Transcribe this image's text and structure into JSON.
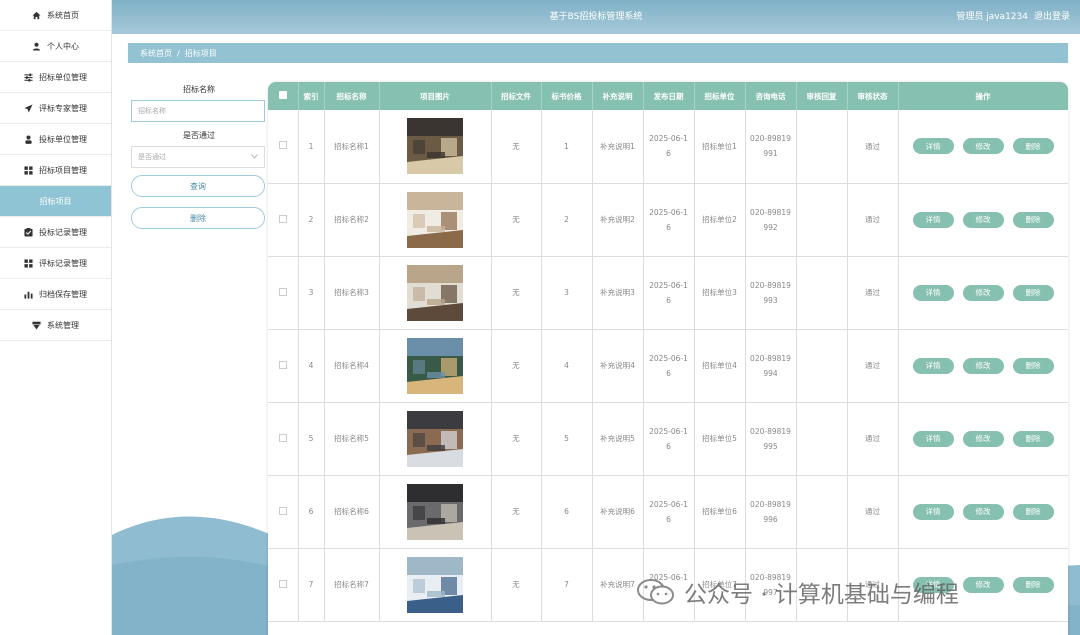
{
  "header": {
    "title": "基于BS招投标管理系统",
    "user_label": "管理员 java1234",
    "logout_label": "退出登录"
  },
  "sidebar": {
    "items": [
      {
        "label": "系统首页",
        "icon": "home-icon"
      },
      {
        "label": "个人中心",
        "icon": "user-icon"
      },
      {
        "label": "招标单位管理",
        "icon": "sliders-icon"
      },
      {
        "label": "评标专家管理",
        "icon": "send-icon"
      },
      {
        "label": "投标单位管理",
        "icon": "person-icon"
      },
      {
        "label": "招标项目管理",
        "icon": "grid-icon"
      },
      {
        "label": "招标项目",
        "icon": ""
      },
      {
        "label": "投标记录管理",
        "icon": "checkbox-icon"
      },
      {
        "label": "评标记录管理",
        "icon": "grid-icon"
      },
      {
        "label": "归档保存管理",
        "icon": "bar-chart-icon"
      },
      {
        "label": "系统管理",
        "icon": "shield-icon"
      }
    ]
  },
  "breadcrumb": {
    "home": "系统首页",
    "separator": "/",
    "current": "招标项目"
  },
  "search": {
    "name_label": "招标名称",
    "name_placeholder": "招标名称",
    "approved_label": "是否通过",
    "approved_placeholder": "是否通过",
    "query_button": "查询",
    "delete_button": "删除"
  },
  "table": {
    "headers": [
      "索引",
      "招标名称",
      "项目图片",
      "招标文件",
      "标书价格",
      "补充说明",
      "发布日期",
      "招标单位",
      "咨询电话",
      "审核回复",
      "审核状态",
      "操作"
    ],
    "rows": [
      {
        "index": "1",
        "name": "招标名称1",
        "file": "无",
        "price": "1",
        "note": "补充说明1",
        "date": [
          "2025-06-1",
          "6"
        ],
        "unit": "招标单位1",
        "phone": [
          "020-89819",
          "991"
        ],
        "reply": "",
        "status": "通过"
      },
      {
        "index": "2",
        "name": "招标名称2",
        "file": "无",
        "price": "2",
        "note": "补充说明2",
        "date": [
          "2025-06-1",
          "6"
        ],
        "unit": "招标单位2",
        "phone": [
          "020-89819",
          "992"
        ],
        "reply": "",
        "status": "通过"
      },
      {
        "index": "3",
        "name": "招标名称3",
        "file": "无",
        "price": "3",
        "note": "补充说明3",
        "date": [
          "2025-06-1",
          "6"
        ],
        "unit": "招标单位3",
        "phone": [
          "020-89819",
          "993"
        ],
        "reply": "",
        "status": "通过"
      },
      {
        "index": "4",
        "name": "招标名称4",
        "file": "无",
        "price": "4",
        "note": "补充说明4",
        "date": [
          "2025-06-1",
          "6"
        ],
        "unit": "招标单位4",
        "phone": [
          "020-89819",
          "994"
        ],
        "reply": "",
        "status": "通过"
      },
      {
        "index": "5",
        "name": "招标名称5",
        "file": "无",
        "price": "5",
        "note": "补充说明5",
        "date": [
          "2025-06-1",
          "6"
        ],
        "unit": "招标单位5",
        "phone": [
          "020-89819",
          "995"
        ],
        "reply": "",
        "status": "通过"
      },
      {
        "index": "6",
        "name": "招标名称6",
        "file": "无",
        "price": "6",
        "note": "补充说明6",
        "date": [
          "2025-06-1",
          "6"
        ],
        "unit": "招标单位6",
        "phone": [
          "020-89819",
          "996"
        ],
        "reply": "",
        "status": "通过"
      },
      {
        "index": "7",
        "name": "招标名称7",
        "file": "无",
        "price": "7",
        "note": "补充说明7",
        "date": [
          "2025-06-1",
          "6"
        ],
        "unit": "招标单位7",
        "phone": [
          "020-89819",
          "997"
        ],
        "reply": "",
        "status": "通过"
      }
    ],
    "actions": {
      "detail": "详情",
      "edit": "修改",
      "delete": "删除"
    }
  },
  "watermark": {
    "text": "公众号 · 计算机基础与编程"
  },
  "colors": {
    "header": "#8fbdd0",
    "accent": "#86c0b0",
    "sidebar_active": "#8fc4d4"
  }
}
